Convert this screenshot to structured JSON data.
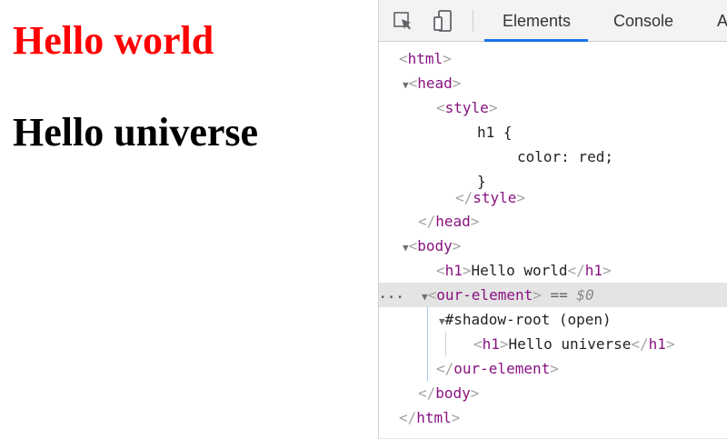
{
  "page": {
    "heading_red": "Hello world",
    "heading_black": "Hello universe",
    "colors": {
      "red_heading": "#ff0000",
      "black_heading": "#000000"
    }
  },
  "devtools": {
    "toolbar": {
      "inspect_icon": "inspect-element-icon",
      "device_icon": "device-toolbar-icon",
      "tabs": [
        "Elements",
        "Console",
        "A"
      ],
      "active_tab": "Elements"
    },
    "tree": {
      "html_open": "<html>",
      "head_open": "<head>",
      "style_open": "<style>",
      "css_selector": "h1 {",
      "css_decl": "color: red;",
      "css_close": "}",
      "style_close": "</style>",
      "head_close": "</head>",
      "body_open": "<body>",
      "h1_open": "<h1>",
      "h1_text": "Hello world",
      "h1_close": "</h1>",
      "selected_dots": "...",
      "our_open": "<our-element>",
      "selected_marker": "== $0",
      "shadow_root": "#shadow-root (open)",
      "shadow_h1_open": "<h1>",
      "shadow_h1_text": "Hello universe",
      "shadow_h1_close": "</h1>",
      "our_close": "</our-element>",
      "body_close": "</body>",
      "html_close": "</html>"
    }
  }
}
